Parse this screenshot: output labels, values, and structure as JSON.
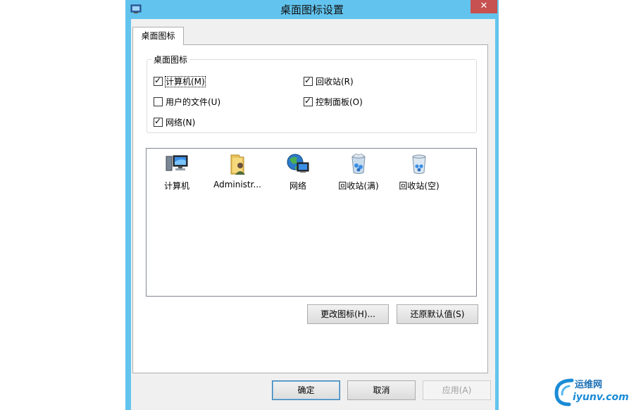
{
  "window": {
    "title": "桌面图标设置",
    "close_label": "✕",
    "accent_color": "#62c4ee"
  },
  "tabs": [
    {
      "label": "桌面图标",
      "active": true
    }
  ],
  "group": {
    "legend": "桌面图标",
    "checkboxes": [
      {
        "label": "计算机(M)",
        "checked": true
      },
      {
        "label": "回收站(R)",
        "checked": true
      },
      {
        "label": "用户的文件(U)",
        "checked": false
      },
      {
        "label": "控制面板(O)",
        "checked": true
      },
      {
        "label": "网络(N)",
        "checked": true
      }
    ]
  },
  "icon_list": {
    "items": [
      {
        "label": "计算机",
        "icon": "computer-icon"
      },
      {
        "label": "Administr...",
        "icon": "user-folder-icon"
      },
      {
        "label": "网络",
        "icon": "network-icon"
      },
      {
        "label": "回收站(满)",
        "icon": "recycle-bin-full-icon"
      },
      {
        "label": "回收站(空)",
        "icon": "recycle-bin-empty-icon"
      }
    ]
  },
  "buttons": {
    "change_icon": "更改图标(H)...",
    "restore_default": "还原默认值(S)",
    "ok": "确定",
    "cancel": "取消",
    "apply": "应用(A)"
  },
  "watermark": {
    "cn": "运维网",
    "en": "iyunv.com"
  }
}
